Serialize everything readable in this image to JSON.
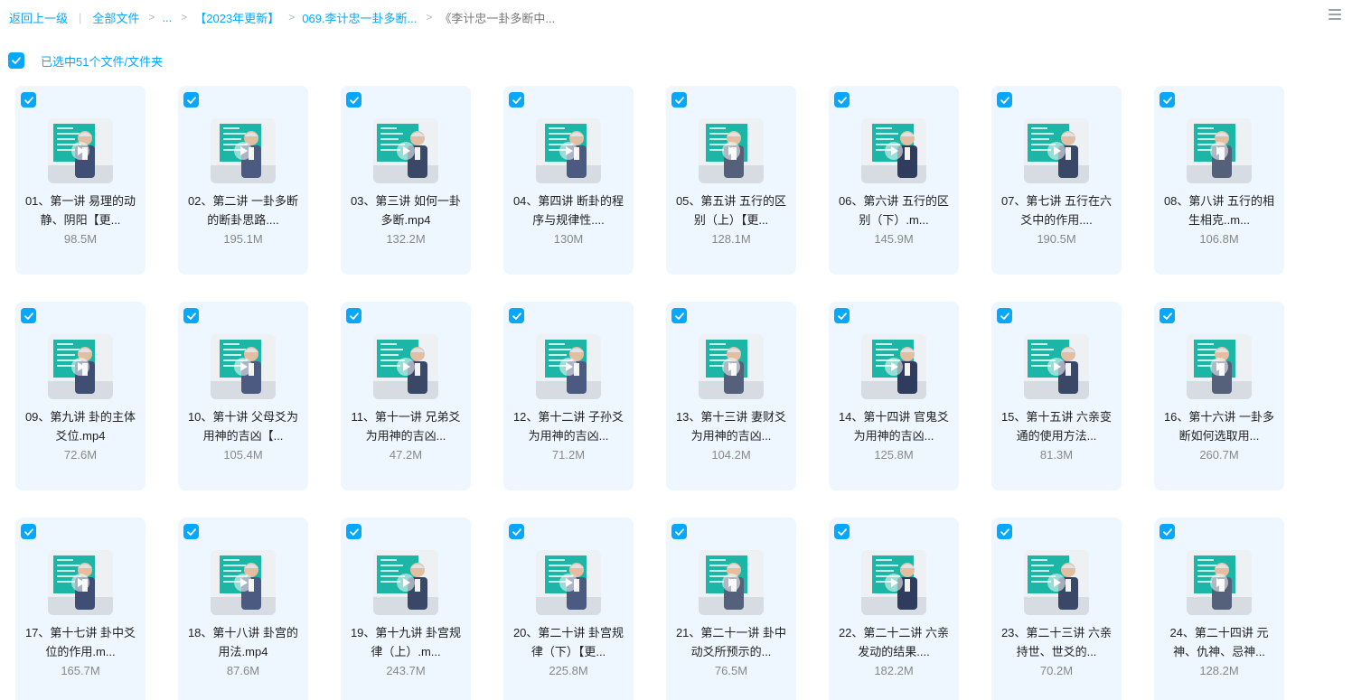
{
  "breadcrumb": {
    "back": "返回上一级",
    "all_files": "全部文件",
    "ellipsis": "...",
    "item_2023": "【2023年更新】",
    "item_069": "069.李计忠一卦多断...",
    "current": "《李计忠一卦多断中..."
  },
  "selection": {
    "label": "已选中51个文件/文件夹",
    "checked": true
  },
  "icons": {
    "checkbox": "checkbox-checked-icon",
    "view": "list-view-icon",
    "play": "play-icon"
  },
  "colors": {
    "accent": "#06a7ff",
    "card_bg": "#eef7ff",
    "board": "#1bb6a6"
  },
  "files": [
    {
      "name": "01、第一讲 易理的动静、阴阳【更...",
      "size": "98.5M"
    },
    {
      "name": "02、第二讲 一卦多断的断卦思路....",
      "size": "195.1M"
    },
    {
      "name": "03、第三讲 如何一卦多断.mp4",
      "size": "132.2M"
    },
    {
      "name": "04、第四讲 断卦的程序与规律性....",
      "size": "130M"
    },
    {
      "name": "05、第五讲 五行的区别（上）【更...",
      "size": "128.1M"
    },
    {
      "name": "06、第六讲 五行的区别（下）.m...",
      "size": "145.9M"
    },
    {
      "name": "07、第七讲 五行在六爻中的作用....",
      "size": "190.5M"
    },
    {
      "name": "08、第八讲 五行的相生相克..m...",
      "size": "106.8M"
    },
    {
      "name": "09、第九讲 卦的主体爻位.mp4",
      "size": "72.6M"
    },
    {
      "name": "10、第十讲 父母爻为用神的吉凶【...",
      "size": "105.4M"
    },
    {
      "name": "11、第十一讲 兄弟爻为用神的吉凶...",
      "size": "47.2M"
    },
    {
      "name": "12、第十二讲 子孙爻为用神的吉凶...",
      "size": "71.2M"
    },
    {
      "name": "13、第十三讲 妻财爻为用神的吉凶...",
      "size": "104.2M"
    },
    {
      "name": "14、第十四讲 官鬼爻为用神的吉凶...",
      "size": "125.8M"
    },
    {
      "name": "15、第十五讲 六亲变通的使用方法...",
      "size": "81.3M"
    },
    {
      "name": "16、第十六讲 一卦多断如何选取用...",
      "size": "260.7M"
    },
    {
      "name": "17、第十七讲 卦中爻位的作用.m...",
      "size": "165.7M"
    },
    {
      "name": "18、第十八讲 卦宫的用法.mp4",
      "size": "87.6M"
    },
    {
      "name": "19、第十九讲 卦宫规律（上）.m...",
      "size": "243.7M"
    },
    {
      "name": "20、第二十讲 卦宫规律（下）【更...",
      "size": "225.8M"
    },
    {
      "name": "21、第二十一讲 卦中动爻所预示的...",
      "size": "76.5M"
    },
    {
      "name": "22、第二十二讲 六亲发动的结果....",
      "size": "182.2M"
    },
    {
      "name": "23、第二十三讲 六亲持世、世爻的...",
      "size": "70.2M"
    },
    {
      "name": "24、第二十四讲 元神、仇神、忌神...",
      "size": "128.2M"
    }
  ]
}
